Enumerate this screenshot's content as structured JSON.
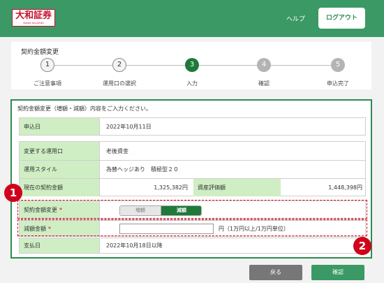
{
  "header": {
    "logo_text": "大和証券",
    "logo_sub": "Daiwa Securities",
    "help_label": "ヘルプ",
    "logout_label": "ログアウト"
  },
  "page_title": "契約金額変更",
  "steps": [
    {
      "number": "1",
      "label": "ご注意事項",
      "state": "done"
    },
    {
      "number": "2",
      "label": "運用口の選択",
      "state": "done"
    },
    {
      "number": "3",
      "label": "入力",
      "state": "active"
    },
    {
      "number": "4",
      "label": "確認",
      "state": "todo"
    },
    {
      "number": "5",
      "label": "申込完了",
      "state": "todo"
    }
  ],
  "form": {
    "instruction": "契約金額変更（増額・減額）内容をご入力ください。",
    "apply_date": {
      "label": "申込日",
      "value": "2022年10月11日"
    },
    "account": {
      "label": "変更する運用口",
      "value": "老後資金"
    },
    "style": {
      "label": "運用スタイル",
      "value": "為替ヘッジあり　積極型２０"
    },
    "current_amount": {
      "label": "現在の契約金額",
      "value": "1,325,382円"
    },
    "asset_value": {
      "label": "資産評価額",
      "value": "1,448,398円"
    },
    "change_type": {
      "label": "契約金額変更",
      "required_mark": "*",
      "options": [
        "増額",
        "減額"
      ],
      "selected": "減額"
    },
    "decrease_amount": {
      "label": "減額金額",
      "required_mark": "*",
      "value": "",
      "unit_note": "円（1万円以上/1万円単位）"
    },
    "payment_date": {
      "label": "支払日",
      "value": "2022年10月18日以降"
    }
  },
  "annotations": {
    "callout_1": "1",
    "callout_2": "2"
  },
  "buttons": {
    "back": "戻る",
    "confirm": "確認"
  },
  "colors": {
    "brand_green": "#3a9964",
    "active_green": "#1f7a3a",
    "label_bg": "#cfeec4",
    "annotation_red": "#d0021b",
    "logo_red": "#c8102e"
  }
}
